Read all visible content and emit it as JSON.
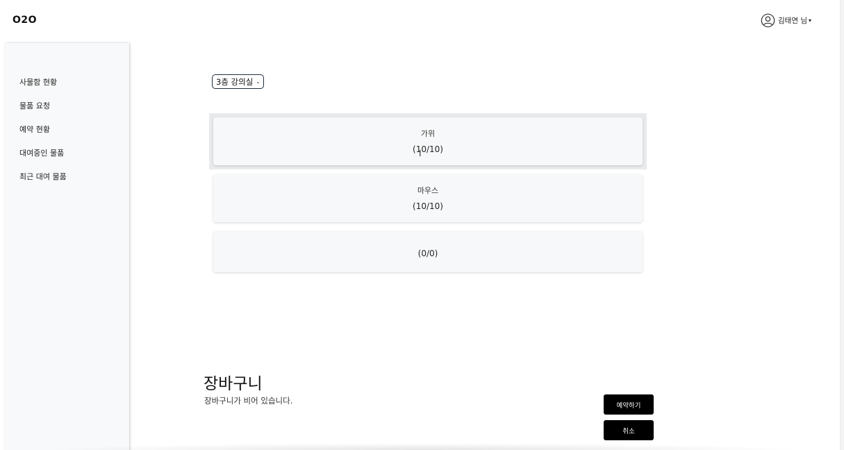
{
  "header": {
    "logo": "O2O",
    "user_name": "김태연 님",
    "user_caret": "▾"
  },
  "sidebar": {
    "items": [
      {
        "label": "사물함 현황"
      },
      {
        "label": "물품 요청"
      },
      {
        "label": "예약 현황"
      },
      {
        "label": "대여중인 물품"
      },
      {
        "label": "최근 대여 물품"
      }
    ]
  },
  "room_select": {
    "selected": "3층 강의실"
  },
  "items": [
    {
      "name": "가위",
      "count": "(10/10)"
    },
    {
      "name": "마우스",
      "count": "(10/10)"
    },
    {
      "name": "",
      "count": "(0/0)"
    }
  ],
  "cart": {
    "title": "장바구니",
    "empty_message": "장바구니가 비어 있습니다.",
    "reserve_label": "예약하기",
    "cancel_label": "취소"
  }
}
